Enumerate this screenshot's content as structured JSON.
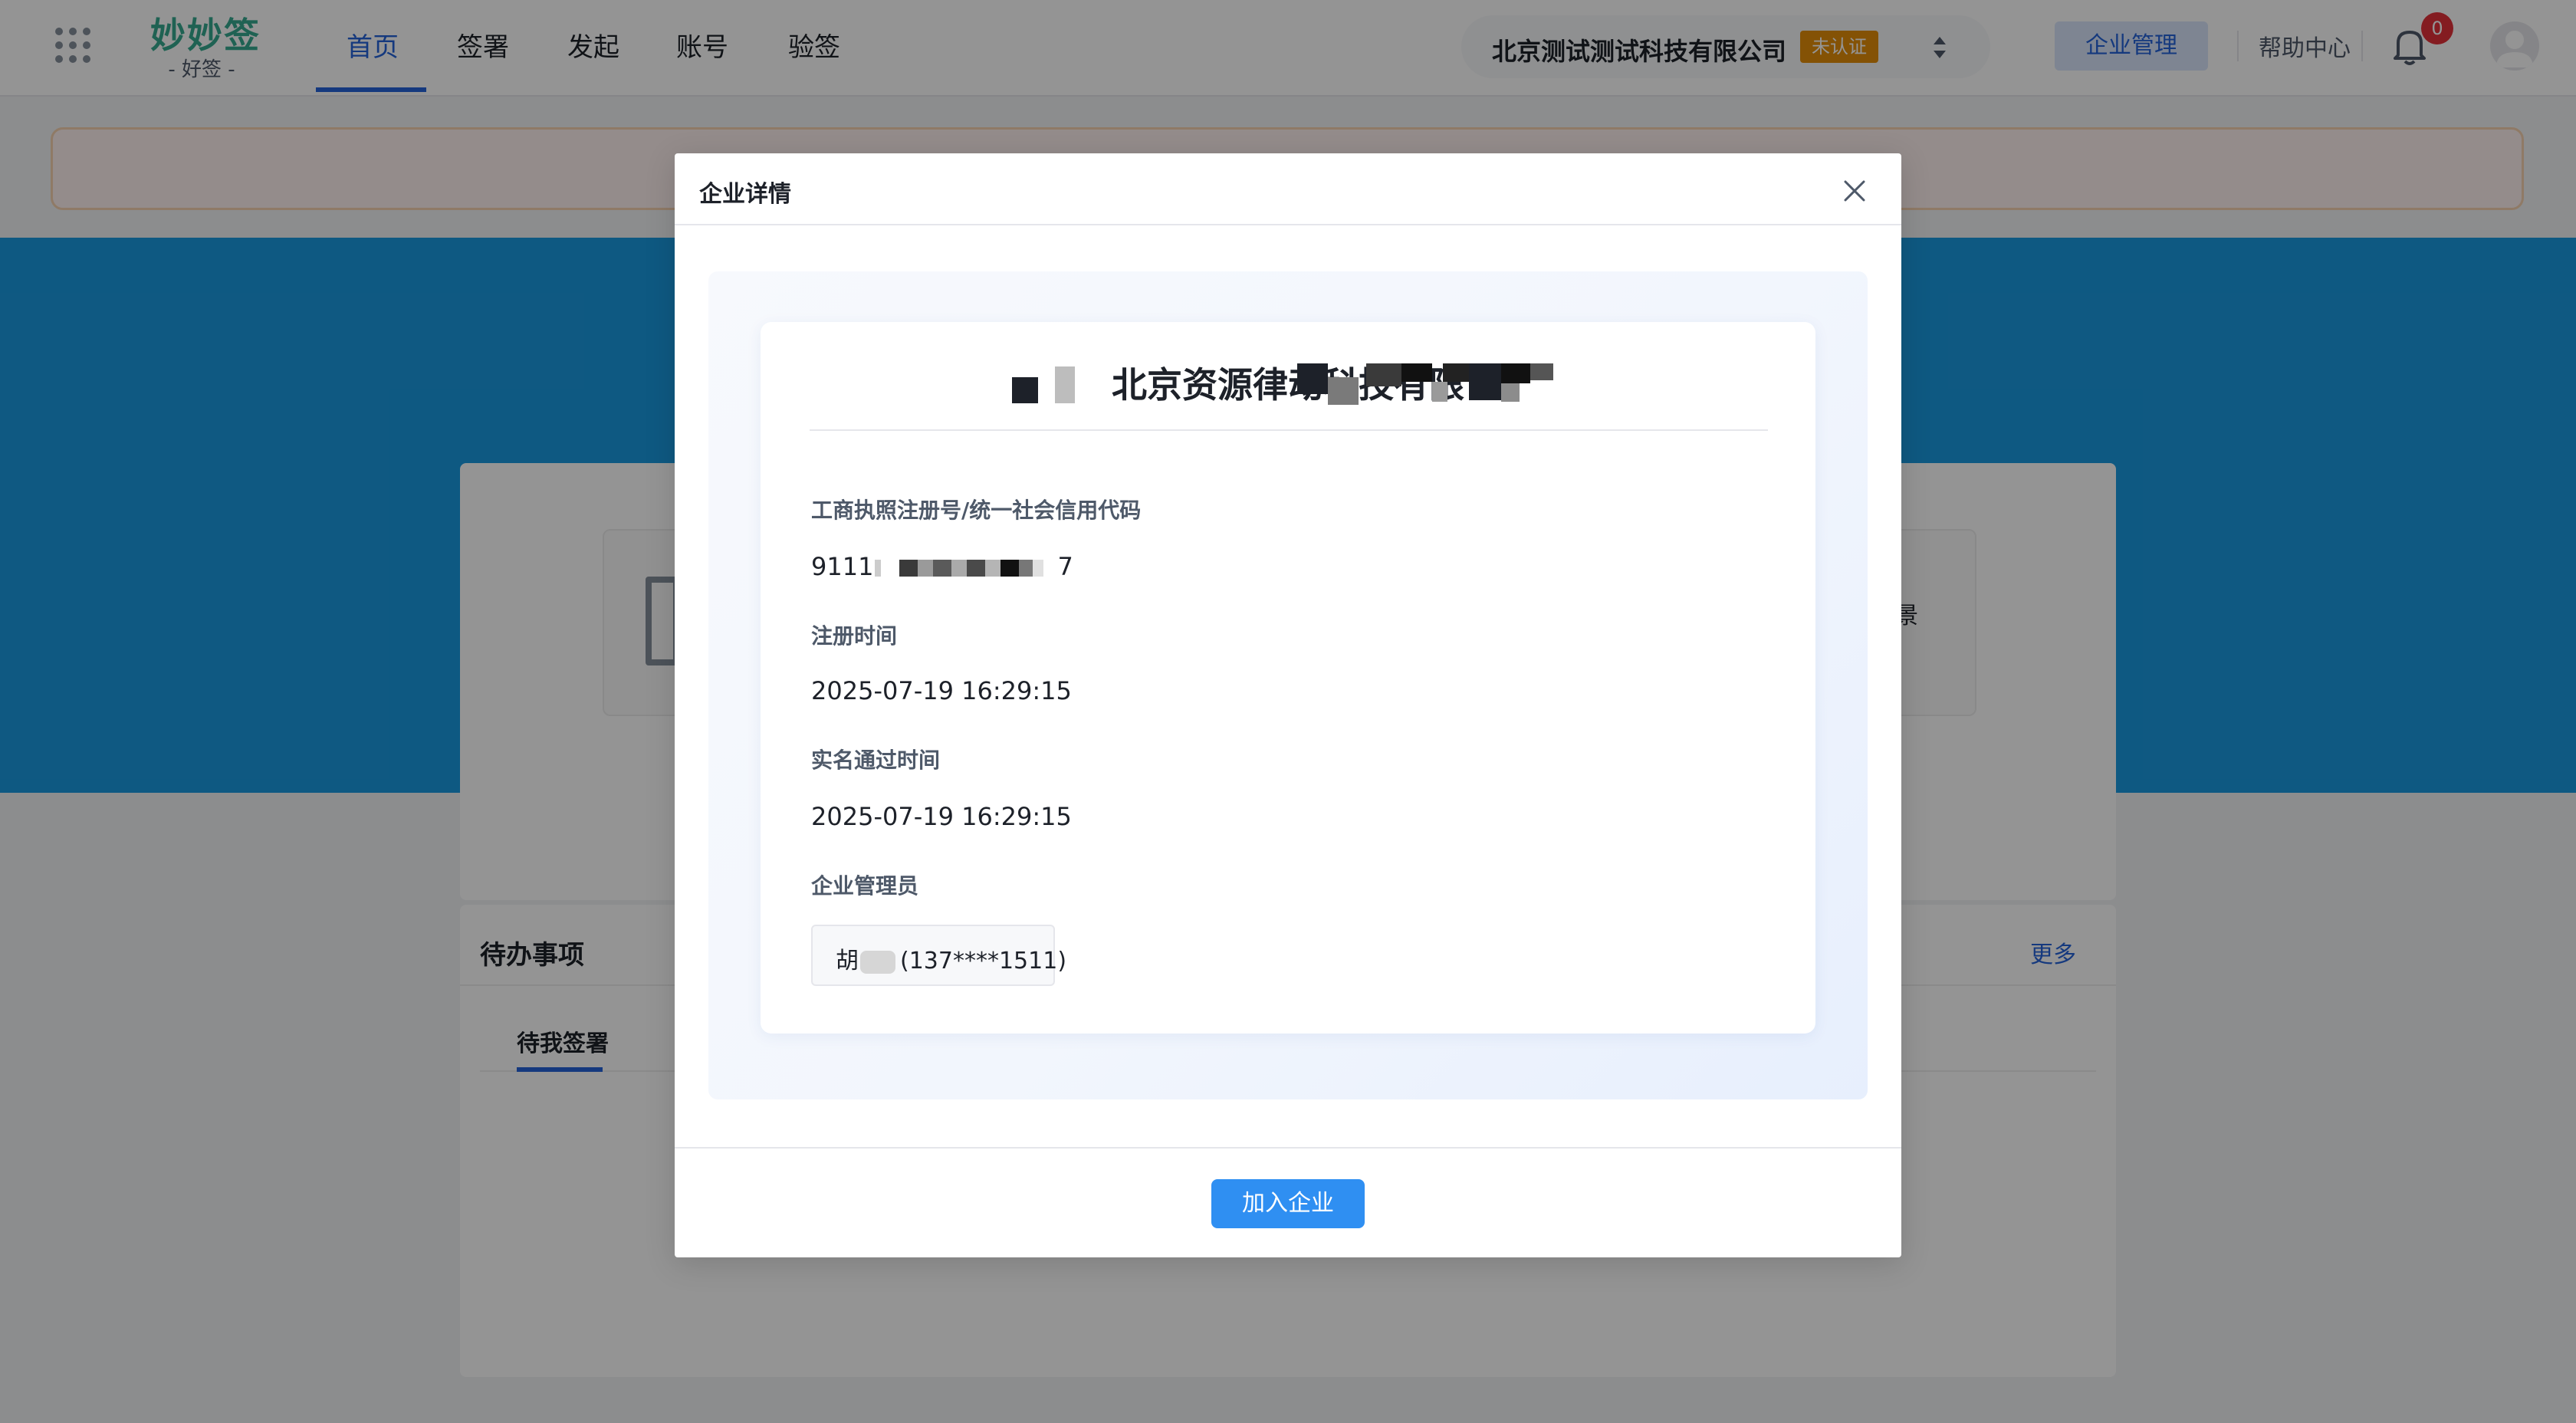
{
  "header": {
    "logo_main": "妙妙签",
    "logo_sub": "-   好签   -",
    "nav": [
      {
        "label": "首页",
        "active": true
      },
      {
        "label": "签署",
        "active": false
      },
      {
        "label": "发起",
        "active": false
      },
      {
        "label": "账号",
        "active": false
      },
      {
        "label": "验签",
        "active": false
      }
    ],
    "company_name": "北京测试测试科技有限公司",
    "cert_status": "未认证",
    "manage_label": "企业管理",
    "help_label": "帮助中心",
    "notification_count": "0",
    "icons": [
      "apps-grid-icon",
      "swap-icon",
      "bell-icon",
      "avatar-icon"
    ]
  },
  "background": {
    "scene_text": "景",
    "todo": {
      "title": "待办事项",
      "more": "更多",
      "tab": "待我签署"
    }
  },
  "modal": {
    "title": "企业详情",
    "company_name": "北京资源律动科技有限",
    "fields": [
      {
        "label": "工商执照注册号/统一社会信用代码",
        "value": "9111",
        "value_suffix": "7",
        "redacted": true
      },
      {
        "label": "注册时间",
        "value": "2025-07-19 16:29:15"
      },
      {
        "label": "实名通过时间",
        "value": "2025-07-19 16:29:15"
      },
      {
        "label": "企业管理员",
        "value": "胡",
        "value_suffix": "(137****1511)"
      }
    ],
    "join_label": "加入企业"
  },
  "colors": {
    "primary": "#2563d9",
    "button": "#2f8ff2",
    "banner": "#1999e0",
    "logo": "#36a98f",
    "badge_orange": "#e38d0a",
    "alert_red": "#e3313a"
  }
}
